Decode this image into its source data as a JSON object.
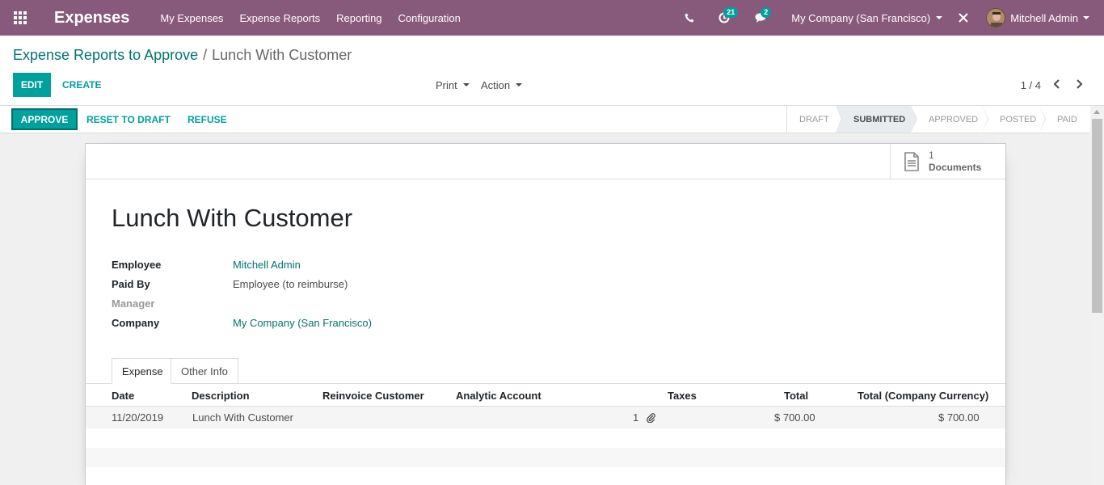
{
  "navbar": {
    "brand": "Expenses",
    "menu": [
      "My Expenses",
      "Expense Reports",
      "Reporting",
      "Configuration"
    ],
    "activities_count": "21",
    "messages_count": "2",
    "company": "My Company (San Francisco)",
    "user": "Mitchell Admin",
    "icons": [
      "apps-icon",
      "phone-icon",
      "activity-clock-icon",
      "chat-icon",
      "debug-tools-icon"
    ]
  },
  "breadcrumb": {
    "parent": "Expense Reports to Approve",
    "separator": "/",
    "current": "Lunch With Customer"
  },
  "control": {
    "edit_label": "EDIT",
    "create_label": "CREATE",
    "print_label": "Print",
    "action_label": "Action",
    "pager": "1 / 4"
  },
  "statusbar": {
    "approve_label": "APPROVE",
    "reset_label": "RESET TO DRAFT",
    "refuse_label": "REFUSE",
    "stages": [
      "DRAFT",
      "SUBMITTED",
      "APPROVED",
      "POSTED",
      "PAID"
    ],
    "active_stage": "SUBMITTED"
  },
  "sheet": {
    "documents_count": "1",
    "documents_label": "Documents",
    "title": "Lunch With Customer",
    "fields": [
      {
        "label": "Employee",
        "value": "Mitchell Admin"
      },
      {
        "label": "Paid By",
        "value": "Employee (to reimburse)"
      },
      {
        "label": "Manager",
        "value": ""
      },
      {
        "label": "Company",
        "value": "My Company (San Francisco)"
      }
    ],
    "tabs": [
      "Expense",
      "Other Info"
    ]
  },
  "expense_table": {
    "headers": [
      "Date",
      "Description",
      "Reinvoice Customer",
      "Analytic Account",
      "Taxes",
      "Total",
      "Total (Company Currency)"
    ],
    "rows": [
      {
        "date": "11/20/2019",
        "description": "Lunch With Customer",
        "reinvoice_customer": "",
        "analytic_account": "",
        "attachments": "1",
        "taxes": "",
        "total": "$ 700.00",
        "total_company": "$ 700.00"
      }
    ]
  },
  "colors": {
    "navbar": "#875a7b",
    "primary": "#00a09d",
    "link": "#00746f"
  }
}
